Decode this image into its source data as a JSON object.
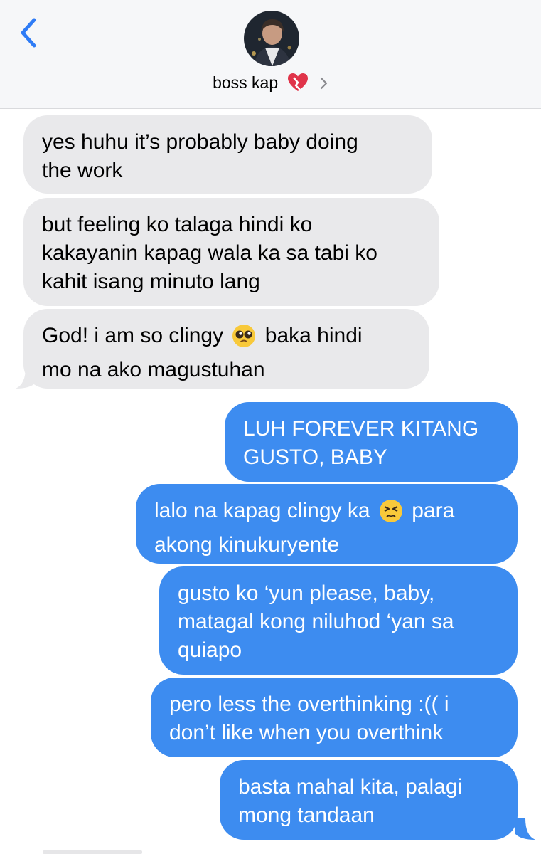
{
  "header": {
    "back_icon": "chevron-left-icon",
    "contact_name": "boss kap",
    "heart_icon": "heart-emoji-icon",
    "chevron_icon": "chevron-right-icon"
  },
  "messages": {
    "m1": {
      "lines": [
        "yes huhu it’s probably baby doing",
        "the work"
      ],
      "side": "received"
    },
    "m2": {
      "lines": [
        "but feeling ko talaga hindi ko",
        "kakayanin kapag wala ka sa tabi ko",
        "kahit isang minuto lang"
      ],
      "side": "received"
    },
    "m3": {
      "line1_a": "God! i am so clingy",
      "line1_b": "baka hindi",
      "line2": "mo na ako magustuhan",
      "emoji": "pleading-face-icon",
      "side": "received"
    },
    "m4": {
      "lines": [
        "LUH FOREVER KITANG",
        "GUSTO, BABY"
      ],
      "side": "sent"
    },
    "m5": {
      "line1_a": "lalo na kapag clingy ka",
      "line1_b": "para",
      "line2": "akong kinukuryente",
      "emoji": "persevering-face-icon",
      "side": "sent"
    },
    "m6": {
      "lines": [
        "gusto ko ‘yun please, baby,",
        "matagal kong niluhod ‘yan sa",
        "quiapo"
      ],
      "side": "sent"
    },
    "m7": {
      "lines": [
        "pero less the overthinking :(( i",
        "don’t like when you overthink"
      ],
      "side": "sent"
    },
    "m8": {
      "lines": [
        "basta mahal kita, palagi",
        "mong tandaan"
      ],
      "side": "sent"
    }
  },
  "colors": {
    "received_bubble": "#e9e9eb",
    "sent_bubble": "#3d8cf0",
    "accent": "#2f7cf6",
    "header_bg": "#f6f7f9"
  }
}
